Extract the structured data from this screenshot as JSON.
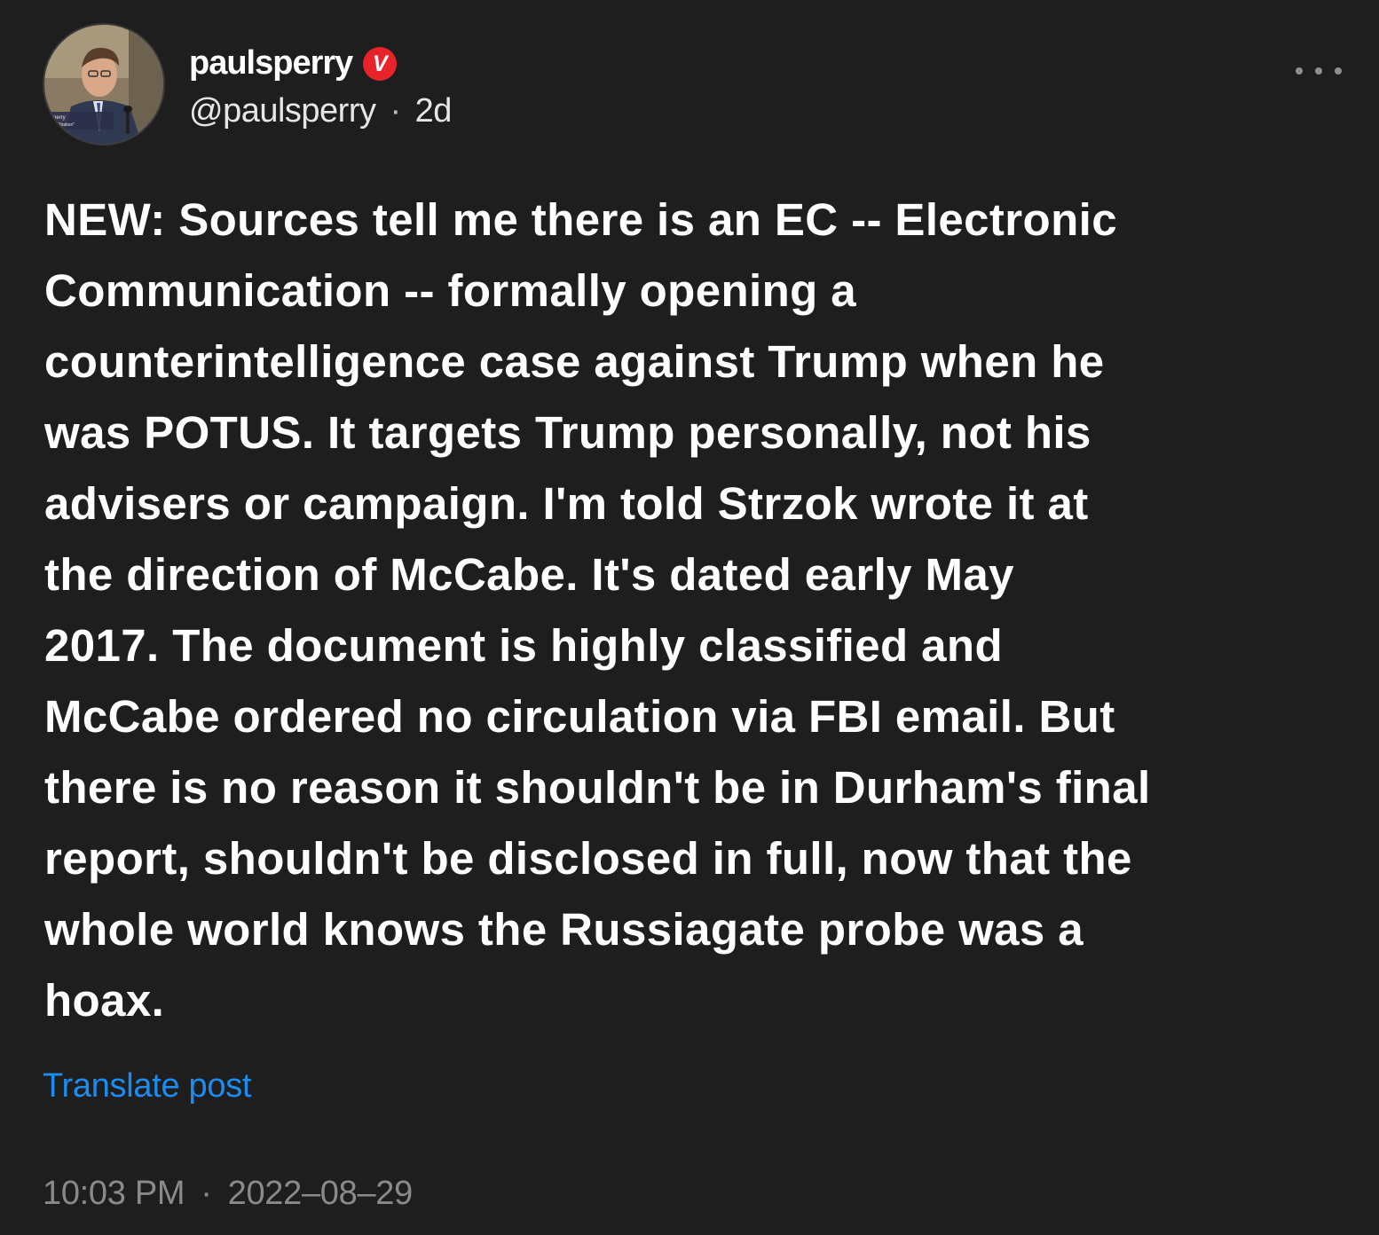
{
  "post": {
    "author": {
      "display_name": "paulsperry",
      "verified_badge_letter": "V",
      "handle": "@paulsperry",
      "avatar_icon": "person-at-podium-photo"
    },
    "relative_time": "2d",
    "separator": "·",
    "more_icon": "ellipsis-icon",
    "text": "NEW: Sources tell me there is an EC -- Electronic\nCommunication -- formally opening a\ncounterintelligence case against Trump when he\nwas POTUS. It targets Trump personally, not his\nadvisers or campaign. I'm told Strzok wrote it at\nthe direction of McCabe. It's dated early May\n2017. The document is highly classified and\nMcCabe ordered no circulation via FBI email. But\nthere is no reason it shouldn't be in Durham's final\nreport, shouldn't be disclosed in full, now that the\nwhole world knows the Russiagate probe was a\nhoax.",
    "translate_label": "Translate post",
    "timestamp_time": "10:03 PM",
    "timestamp_date": "2022–08–29"
  },
  "colors": {
    "background": "#1e1e1e",
    "text": "#ffffff",
    "muted": "#8a8a8a",
    "link": "#1d8cf0",
    "badge": "#e8242a"
  }
}
